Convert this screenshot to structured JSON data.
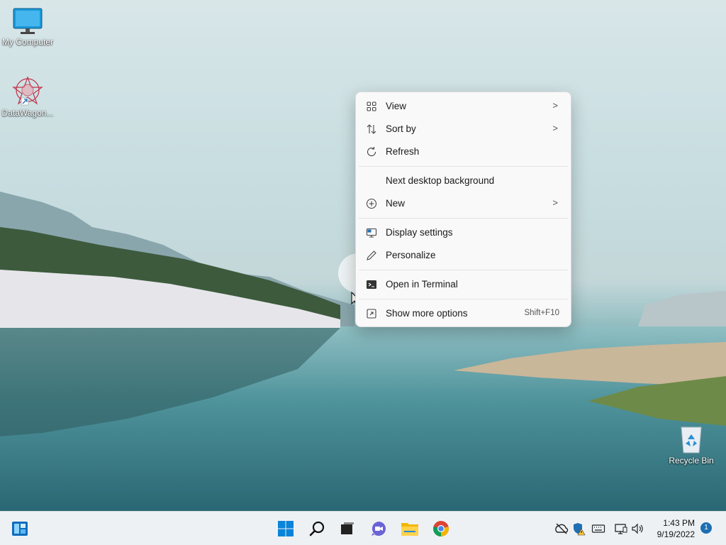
{
  "desktop": {
    "icons": [
      {
        "label": "My Computer",
        "icon": "monitor-icon"
      },
      {
        "label": "DataWagon...",
        "icon": "datawagon-app-icon"
      },
      {
        "label": "Recycle Bin",
        "icon": "recycle-bin-icon"
      }
    ]
  },
  "context_menu": {
    "items": [
      {
        "label": "View",
        "icon": "view-grid-icon",
        "submenu": true
      },
      {
        "label": "Sort by",
        "icon": "sort-icon",
        "submenu": true
      },
      {
        "label": "Refresh",
        "icon": "refresh-icon"
      },
      {
        "label": "Next desktop background"
      },
      {
        "label": "New",
        "icon": "plus-circle-icon",
        "submenu": true
      },
      {
        "label": "Display settings",
        "icon": "display-settings-icon"
      },
      {
        "label": "Personalize",
        "icon": "pen-icon"
      },
      {
        "label": "Open in Terminal",
        "icon": "terminal-icon"
      },
      {
        "label": "Show more options",
        "icon": "expand-icon",
        "shortcut": "Shift+F10"
      }
    ],
    "arrow_glyph": ">"
  },
  "taskbar": {
    "apps": [
      "widgets-icon",
      "start-icon",
      "search-icon",
      "task-view-icon",
      "chat-icon",
      "file-explorer-icon",
      "chrome-icon"
    ],
    "tray": [
      "network-off-icon",
      "security-warning-icon",
      "keyboard-icon",
      "display-icon",
      "volume-icon"
    ],
    "clock": {
      "time": "1:43 PM",
      "date": "9/19/2022"
    },
    "notification_count": "1"
  },
  "colors": {
    "accent": "#0078d4",
    "menu_bg": "#f9f9f9",
    "taskbar_bg": "#eef1f4"
  }
}
